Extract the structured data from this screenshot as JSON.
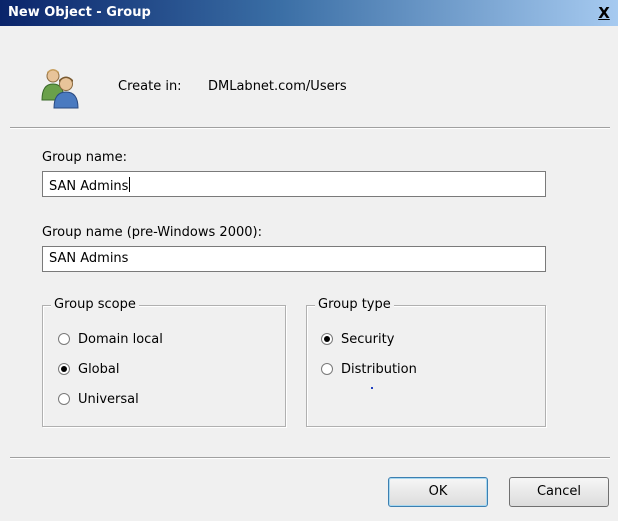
{
  "window": {
    "title": "New Object - Group",
    "close_glyph": "X"
  },
  "header": {
    "icon": "group-users-icon",
    "create_in_label": "Create in:",
    "create_in_value": "DMLabnet.com/Users"
  },
  "fields": {
    "group_name": {
      "label": "Group name:",
      "value": "SAN Admins"
    },
    "group_name_pre2000": {
      "label": "Group name (pre-Windows 2000):",
      "value": "SAN Admins"
    }
  },
  "group_scope": {
    "title": "Group scope",
    "options": [
      {
        "label": "Domain local",
        "selected": false
      },
      {
        "label": "Global",
        "selected": true
      },
      {
        "label": "Universal",
        "selected": false
      }
    ]
  },
  "group_type": {
    "title": "Group type",
    "options": [
      {
        "label": "Security",
        "selected": true
      },
      {
        "label": "Distribution",
        "selected": false
      }
    ]
  },
  "buttons": {
    "ok": "OK",
    "cancel": "Cancel"
  },
  "colors": {
    "titlebar_start": "#0a246a",
    "titlebar_end": "#a6caf0",
    "dialog_bg": "#f0f0f0"
  }
}
